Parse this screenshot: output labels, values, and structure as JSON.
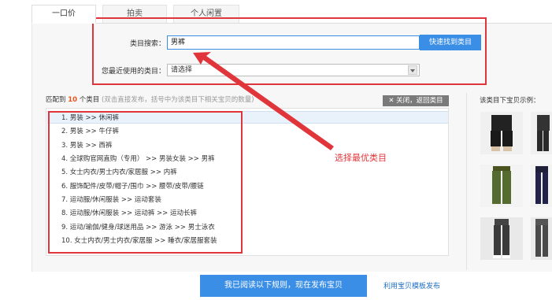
{
  "tabs": [
    {
      "label": "一口价",
      "active": true
    },
    {
      "label": "拍卖",
      "active": false
    },
    {
      "label": "个人闲置",
      "active": false
    }
  ],
  "search": {
    "label": "类目搜索：",
    "value": "男裤",
    "button": "快速找到类目"
  },
  "recent": {
    "label": "您最近使用的类目：",
    "value": "请选择"
  },
  "match": {
    "prefix": "匹配到",
    "count": "10",
    "suffix": "个类目",
    "hint": "(双击直接发布，括号中为该类目下相关宝贝的数量)",
    "close_label": "关闭，返回类目",
    "close_icon": "close-x-icon"
  },
  "results": [
    "1.  男装 >> 休闲裤",
    "2.  男装 >> 牛仔裤",
    "3.  男装 >> 西裤",
    "4.  全球购官网直购（专用） >> 男装女装 >> 男裤",
    "5.  女士内衣/男士内衣/家居服 >> 内裤",
    "6.  服饰配件/皮带/帽子/围巾 >> 腰带/皮带/腰链",
    "7.  运动服/休闲服装 >> 运动套装",
    "8.  运动服/休闲服装 >> 运动裤 >> 运动长裤",
    "9.  运动/瑜伽/健身/球迷用品 >> 游泳 >> 男士泳衣",
    "10.  女士内衣/男士内衣/家居服 >> 睡衣/家居服套装"
  ],
  "preview": {
    "title": "该类目下宝贝示例："
  },
  "annotation": {
    "text": "选择最优类目",
    "color": "#e0363b"
  },
  "footer": {
    "submit_label": "我已阅读以下规则，现在发布宝贝",
    "template_link": "利用宝贝模板发布"
  },
  "colors": {
    "accent": "#3a8ee6",
    "highlight_count": "#e8541e",
    "annotation": "#e0363b"
  }
}
